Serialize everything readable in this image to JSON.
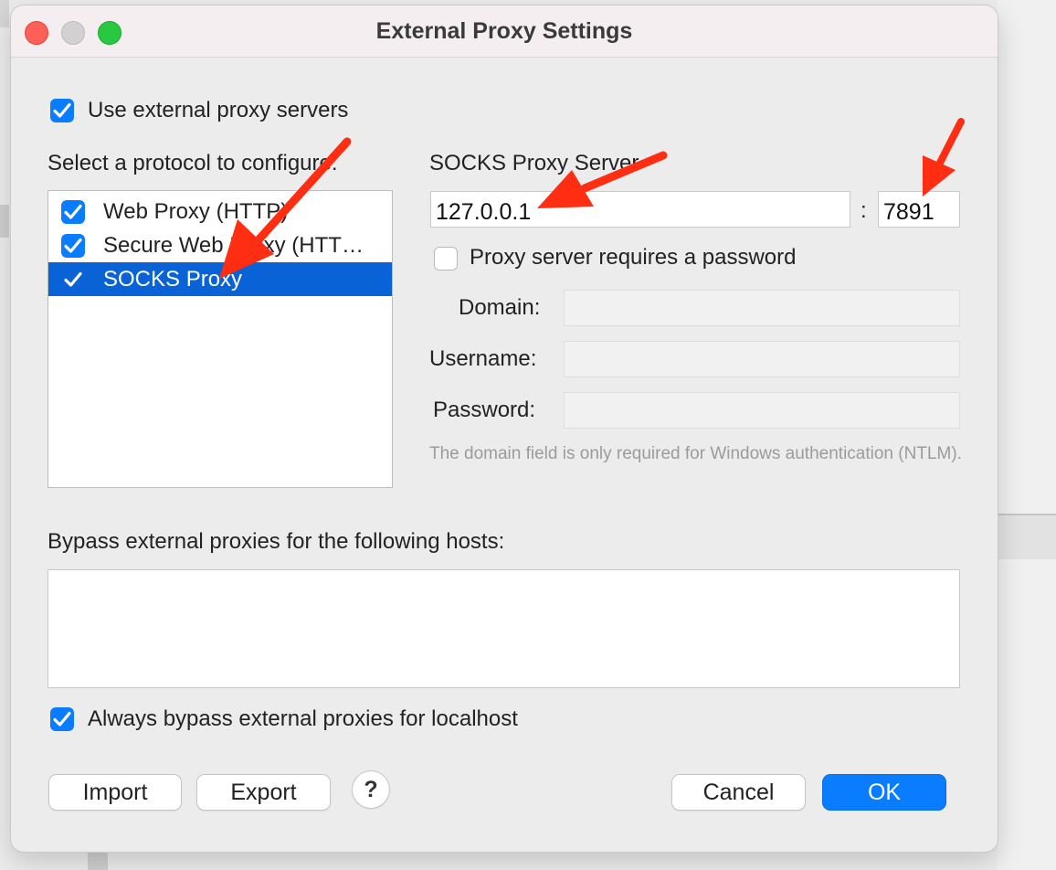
{
  "window": {
    "title": "External Proxy Settings"
  },
  "use_external": {
    "label": "Use external proxy servers",
    "checked": true
  },
  "protocol": {
    "heading": "Select a protocol to configure:",
    "items": [
      {
        "label": "Web Proxy (HTTP)",
        "checked": true,
        "selected": false
      },
      {
        "label": "Secure Web Proxy (HTT…",
        "checked": true,
        "selected": false
      },
      {
        "label": "SOCKS Proxy",
        "checked": true,
        "selected": true
      }
    ]
  },
  "server": {
    "heading": "SOCKS Proxy Server",
    "host": "127.0.0.1",
    "separator": ":",
    "port": "7891",
    "requires_password_label": "Proxy server requires a password",
    "requires_password": false,
    "domain_label": "Domain:",
    "username_label": "Username:",
    "password_label": "Password:",
    "hint": "The domain field is only required for Windows authentication (NTLM)."
  },
  "bypass": {
    "heading": "Bypass external proxies for the following hosts:",
    "value": "",
    "localhost_label": "Always bypass external proxies for localhost",
    "localhost_checked": true
  },
  "buttons": {
    "import": "Import",
    "export": "Export",
    "help": "?",
    "cancel": "Cancel",
    "ok": "OK"
  },
  "colors": {
    "accent": "#0a7cff",
    "selection": "#0a63d6",
    "annotation": "#ff2d12"
  }
}
